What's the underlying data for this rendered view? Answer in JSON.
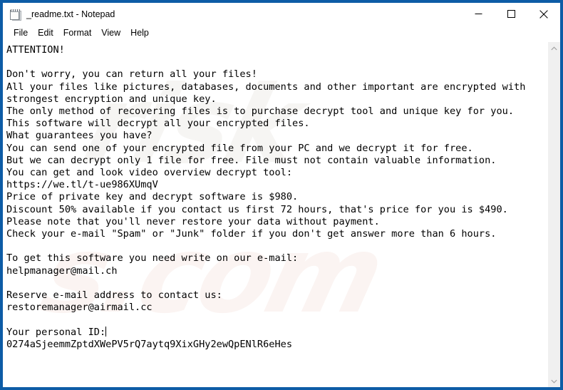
{
  "window": {
    "title": "_readme.txt - Notepad",
    "icon": "notepad-icon",
    "border_color": "#0d5ca6",
    "buttons": {
      "minimize": "Minimize",
      "maximize": "Maximize",
      "close": "Close"
    }
  },
  "menubar": {
    "items": [
      {
        "label": "File"
      },
      {
        "label": "Edit"
      },
      {
        "label": "Format"
      },
      {
        "label": "View"
      },
      {
        "label": "Help"
      }
    ]
  },
  "document": {
    "filename": "_readme.txt",
    "body": "ATTENTION!\n\nDon't worry, you can return all your files!\nAll your files like pictures, databases, documents and other important are encrypted with\nstrongest encryption and unique key.\nThe only method of recovering files is to purchase decrypt tool and unique key for you.\nThis software will decrypt all your encrypted files.\nWhat guarantees you have?\nYou can send one of your encrypted file from your PC and we decrypt it for free.\nBut we can decrypt only 1 file for free. File must not contain valuable information.\nYou can get and look video overview decrypt tool:\nhttps://we.tl/t-ue986XUmqV\nPrice of private key and decrypt software is $980.\nDiscount 50% available if you contact us first 72 hours, that's price for you is $490.\nPlease note that you'll never restore your data without payment.\nCheck your e-mail \"Spam\" or \"Junk\" folder if you don't get answer more than 6 hours.\n\nTo get this software you need write on our e-mail:\nhelpmanager@mail.ch\n\nReserve e-mail address to contact us:\nrestoremanager@airmail.cc\n\nYour personal ID:",
    "personal_id": "0274aSjeemmZptdXWePV5rQ7aytq9XixGHy2ewQpENlR6eHes",
    "lines": [
      "ATTENTION!",
      "",
      "Don't worry, you can return all your files!",
      "All your files like pictures, databases, documents and other important are encrypted with",
      "strongest encryption and unique key.",
      "The only method of recovering files is to purchase decrypt tool and unique key for you.",
      "This software will decrypt all your encrypted files.",
      "What guarantees you have?",
      "You can send one of your encrypted file from your PC and we decrypt it for free.",
      "But we can decrypt only 1 file for free. File must not contain valuable information.",
      "You can get and look video overview decrypt tool:",
      "https://we.tl/t-ue986XUmqV",
      "Price of private key and decrypt software is $980.",
      "Discount 50% available if you contact us first 72 hours, that's price for you is $490.",
      "Please note that you'll never restore your data without payment.",
      "Check your e-mail \"Spam\" or \"Junk\" folder if you don't get answer more than 6 hours.",
      "",
      "To get this software you need write on our e-mail:",
      "helpmanager@mail.ch",
      "",
      "Reserve e-mail address to contact us:",
      "restoremanager@airmail.cc",
      "",
      "Your personal ID:",
      "0274aSjeemmZptdXWePV5rQ7aytq9XixGHy2ewQpENlR6eHes"
    ],
    "url": "https://we.tl/t-ue986XUmqV",
    "price": "$980",
    "discount_price": "$490",
    "discount_percent": "50%",
    "discount_window_hours": "72",
    "answer_window_hours": "6",
    "email_primary": "helpmanager@mail.ch",
    "email_reserve": "restoremanager@airmail.cc"
  },
  "watermark": {
    "text_1": "risk",
    "text_2": "s.com"
  },
  "scrollbar": {
    "up_arrow": "▲",
    "down_arrow": "▼"
  }
}
